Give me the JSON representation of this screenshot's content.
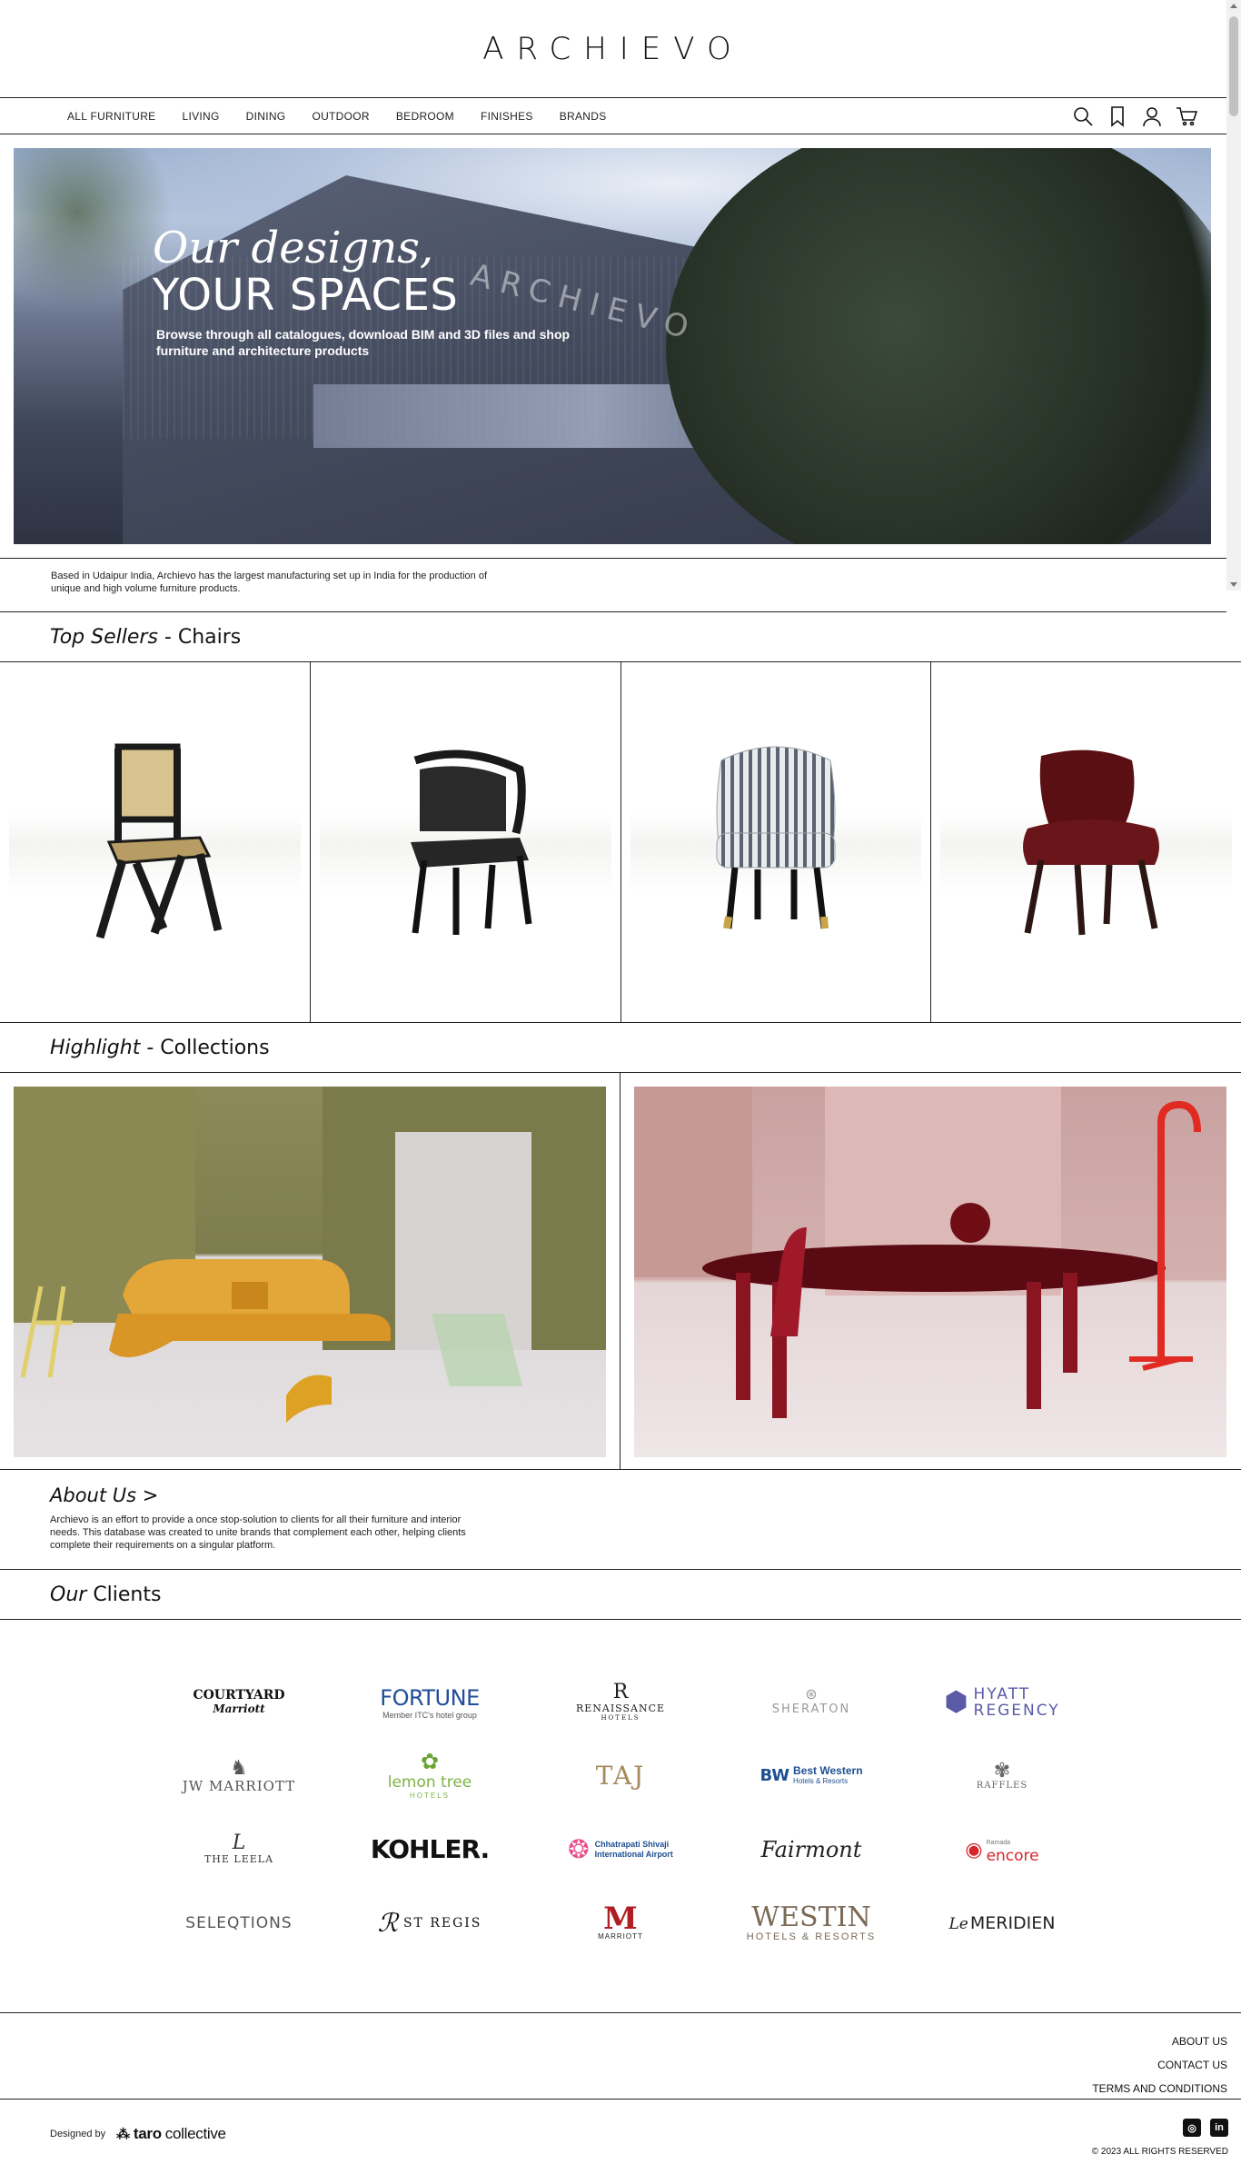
{
  "header": {
    "logo": "ARCHIEVO",
    "nav": [
      "ALL FURNITURE",
      "LIVING",
      "DINING",
      "OUTDOOR",
      "BEDROOM",
      "FINISHES",
      "BRANDS"
    ]
  },
  "hero": {
    "title_line1": "Our designs,",
    "title_line2": "YOUR SPACES",
    "building_sign": "ARCHIEVO",
    "subtitle": "Browse through all catalogues, download BIM and 3D files and shop furniture and architecture products"
  },
  "intro": {
    "text": "Based in Udaipur India, Archievo has the largest manufacturing set up in India for the production of unique and high volume furniture products."
  },
  "top_sellers": {
    "title_italic": "Top Sellers",
    "separator": "-",
    "title_rest": "Chairs",
    "products": [
      "cane-back-chair",
      "black-leather-armchair",
      "striped-upholstered-chair",
      "burgundy-leather-chair"
    ]
  },
  "collections": {
    "title_italic": "Highlight",
    "separator": "-",
    "title_rest": "Collections"
  },
  "about": {
    "title": "About Us >",
    "text": "Archievo is an effort to provide a once stop-solution to clients for all their furniture and interior needs. This database was created to unite brands that complement each other, helping clients complete their requirements on a singular platform."
  },
  "clients": {
    "title_italic": "Our",
    "title_rest": "Clients",
    "courtyard": "COURTYARD",
    "courtyard_sub": "Marriott",
    "fortune": "FORTUNE",
    "fortune_sub": "Member ITC's hotel group",
    "renaissance": "RENAISSANCE",
    "renaissance_sub": "HOTELS",
    "sheraton": "SHERATON",
    "hyatt": "HYATT",
    "hyatt_sub": "REGENCY",
    "jw": "JW MARRIOTT",
    "lemon": "lemon tree",
    "lemon_sub": "HOTELS",
    "taj": "TAJ",
    "bw": "BW",
    "bw_name": "Best Western",
    "bw_sub": "Hotels & Resorts",
    "raffles": "RAFFLES",
    "leela": "THE LEELA",
    "kohler": "KOHLER.",
    "airport": "Chhatrapati Shivaji",
    "airport_sub": "International Airport",
    "fairmont": "Fairmont",
    "encore_pre": "Ramada",
    "encore": "encore",
    "seleqtions": "SELEQTIONS",
    "stregis": "ST REGIS",
    "marriott": "MARRIOTT",
    "westin": "WESTIN",
    "westin_sub": "HOTELS & RESORTS",
    "meridien": "MERIDIEN",
    "meridien_pre": "Le"
  },
  "footer": {
    "links": [
      "ABOUT US",
      "CONTACT US",
      "TERMS AND CONDITIONS"
    ],
    "designed_by": "Designed by",
    "agency_bold": "taro",
    "agency_rest": "collective",
    "social_instagram": "◎",
    "social_linkedin": "in",
    "copyright": "© 2023 ALL RIGHTS RESERVED"
  },
  "colors": {
    "border": "#222222",
    "kohler": "#111111",
    "fortune_blue": "#1f4e9a",
    "fortune_orange": "#e8702a",
    "hyatt": "#5a5aa6",
    "lemon": "#7cb342",
    "taj": "#a68a5b",
    "bw_blue": "#1d4f91",
    "marriott_red": "#b01e23",
    "westin": "#7a6a56",
    "encore_red": "#d6252b"
  }
}
